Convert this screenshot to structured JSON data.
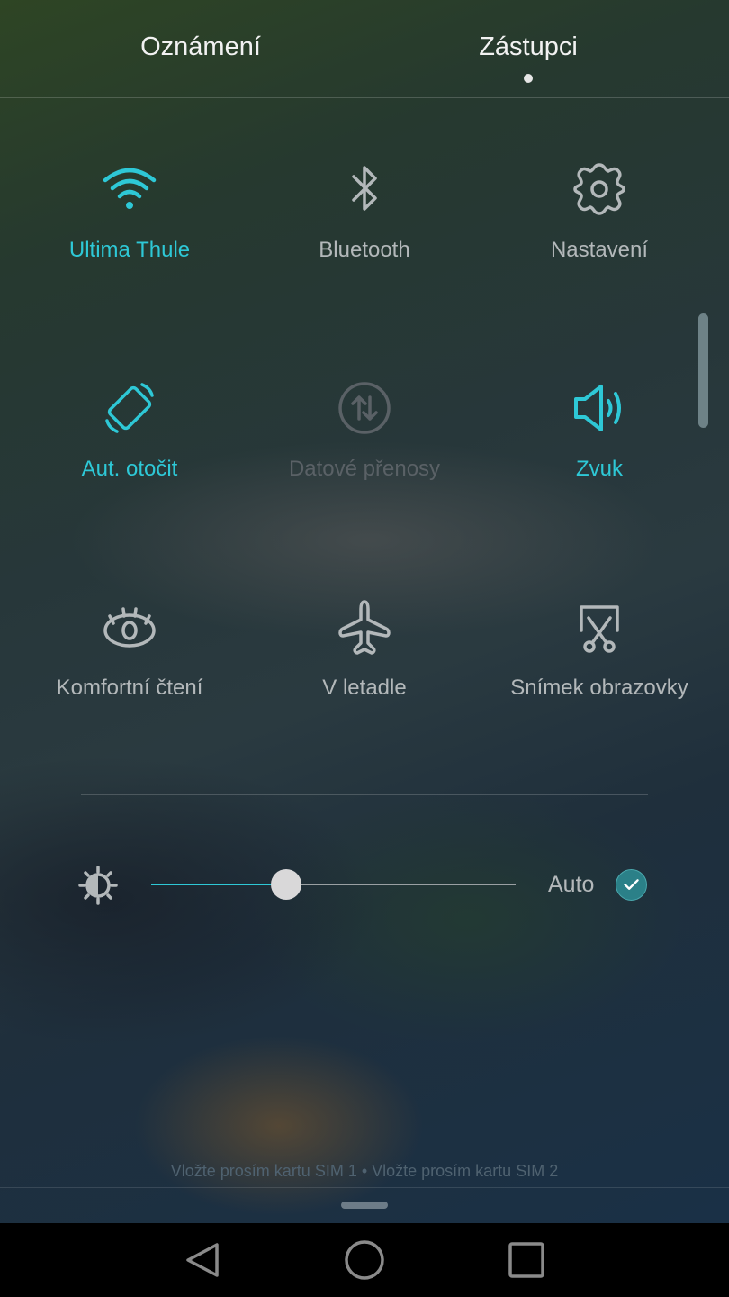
{
  "colors": {
    "accent": "#2ec8d6",
    "inactive": "#b3b8ba",
    "disabled": "#5a6166"
  },
  "header": {
    "tabs": [
      {
        "label": "Oznámení",
        "active": false
      },
      {
        "label": "Zástupci",
        "active": true
      }
    ]
  },
  "tiles": [
    {
      "id": "wifi",
      "icon": "wifi-icon",
      "label": "Ultima Thule",
      "state": "on"
    },
    {
      "id": "bluetooth",
      "icon": "bluetooth-icon",
      "label": "Bluetooth",
      "state": "off"
    },
    {
      "id": "settings",
      "icon": "gear-icon",
      "label": "Nastavení",
      "state": "off"
    },
    {
      "id": "auto-rotate",
      "icon": "rotate-icon",
      "label": "Aut. otočit",
      "state": "on"
    },
    {
      "id": "mobile-data",
      "icon": "data-transfer-icon",
      "label": "Datové přenosy",
      "state": "disabled"
    },
    {
      "id": "sound",
      "icon": "speaker-icon",
      "label": "Zvuk",
      "state": "on"
    },
    {
      "id": "eye-comfort",
      "icon": "eye-icon",
      "label": "Komfortní čtení",
      "state": "off"
    },
    {
      "id": "airplane",
      "icon": "airplane-icon",
      "label": "V letadle",
      "state": "off"
    },
    {
      "id": "screenshot",
      "icon": "screenshot-scissors-icon",
      "label": "Snímek obrazovky",
      "state": "off"
    }
  ],
  "brightness": {
    "level_percent": 37,
    "auto_label": "Auto",
    "auto_checked": true
  },
  "status": {
    "sim_text": "Vložte prosím kartu SIM 1 • Vložte prosím kartu SIM 2"
  },
  "navbar": {
    "buttons": [
      "back",
      "home",
      "recents"
    ]
  }
}
